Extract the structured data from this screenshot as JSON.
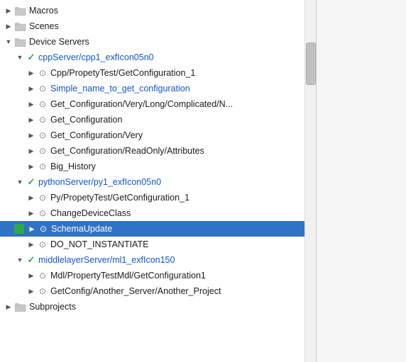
{
  "tree": {
    "items": [
      {
        "id": "macros",
        "label": "Macros",
        "indent": 0,
        "type": "folder",
        "expanded": false,
        "selected": false
      },
      {
        "id": "scenes",
        "label": "Scenes",
        "indent": 0,
        "type": "folder",
        "expanded": false,
        "selected": false
      },
      {
        "id": "device-servers",
        "label": "Device Servers",
        "indent": 0,
        "type": "folder",
        "expanded": true,
        "selected": false
      },
      {
        "id": "cpp-server",
        "label": "cppServer/cpp1_exfIcon05n0",
        "indent": 1,
        "type": "server",
        "expanded": true,
        "selected": false,
        "blue": true
      },
      {
        "id": "cpp-item1",
        "label": "Cpp/PropetyTest/GetConfiguration_1",
        "indent": 2,
        "type": "item",
        "selected": false
      },
      {
        "id": "cpp-item2",
        "label": "Simple_name_to_get_configuration",
        "indent": 2,
        "type": "item",
        "selected": false,
        "blue": true
      },
      {
        "id": "cpp-item3",
        "label": "Get_Configuration/Very/Long/Complicated/N...",
        "indent": 2,
        "type": "item",
        "selected": false
      },
      {
        "id": "cpp-item4",
        "label": "Get_Configuration",
        "indent": 2,
        "type": "item",
        "selected": false
      },
      {
        "id": "cpp-item5",
        "label": "Get_Configuration/Very",
        "indent": 2,
        "type": "item",
        "selected": false
      },
      {
        "id": "cpp-item6",
        "label": "Get_Configuration/ReadOnly/Attributes",
        "indent": 2,
        "type": "item",
        "selected": false
      },
      {
        "id": "cpp-item7",
        "label": "Big_History",
        "indent": 2,
        "type": "item",
        "selected": false
      },
      {
        "id": "py-server",
        "label": "pythonServer/py1_exfIcon05n0",
        "indent": 1,
        "type": "server",
        "expanded": true,
        "selected": false,
        "blue": true
      },
      {
        "id": "py-item1",
        "label": "Py/PropetyTest/GetConfiguration_1",
        "indent": 2,
        "type": "item",
        "selected": false
      },
      {
        "id": "py-item2",
        "label": "ChangeDeviceClass",
        "indent": 2,
        "type": "item",
        "selected": false
      },
      {
        "id": "py-item3",
        "label": "SchemaUpdate",
        "indent": 2,
        "type": "item",
        "selected": true,
        "blue": true,
        "hasGreenSquare": true
      },
      {
        "id": "py-item4",
        "label": "DO_NOT_INSTANTIATE",
        "indent": 2,
        "type": "item",
        "selected": false
      },
      {
        "id": "middle-server",
        "label": "middlelayerServer/ml1_exfIcon150",
        "indent": 1,
        "type": "server",
        "expanded": true,
        "selected": false,
        "blue": true
      },
      {
        "id": "ml-item1",
        "label": "Mdl/PropertyTestMdl/GetConfiguration1",
        "indent": 2,
        "type": "item",
        "selected": false
      },
      {
        "id": "ml-item2",
        "label": "GetConfig/Another_Server/Another_Project",
        "indent": 2,
        "type": "item",
        "selected": false
      },
      {
        "id": "subprojects",
        "label": "Subprojects",
        "indent": 0,
        "type": "folder",
        "expanded": false,
        "selected": false
      }
    ]
  }
}
